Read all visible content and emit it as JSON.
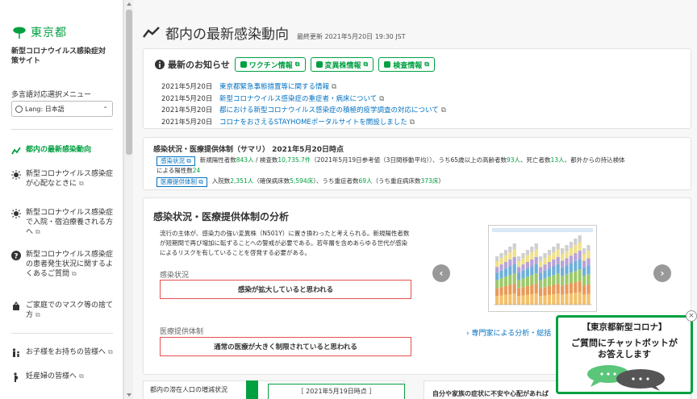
{
  "sidebar": {
    "logo_text": "東京都",
    "site_title": "新型コロナウイルス感染症対策サイト",
    "lang_label": "多言語対応選択メニュー",
    "lang_select_value": "Lang: 日本語",
    "nav": [
      {
        "label": "都内の最新感染動向"
      },
      {
        "label": "新型コロナウイルス感染症が心配なときに"
      },
      {
        "label": "新型コロナウイルス感染症で入院・宿泊療養される方へ"
      },
      {
        "label": "新型コロナウイルス感染症の患者発生状況に関するよくあるご質問"
      },
      {
        "label": "ご家庭でのマスク等の捨て方"
      },
      {
        "label": "お子様をお持ちの皆様へ"
      },
      {
        "label": "妊産婦の皆様へ"
      }
    ]
  },
  "header": {
    "title": "都内の最新感染動向",
    "updated": "最終更新 2021年5月20日 19:30 JST"
  },
  "news": {
    "title": "最新のお知らせ",
    "pills": [
      "ワクチン情報",
      "変異株情報",
      "検査情報"
    ],
    "items": [
      {
        "date": "2021年5月20日",
        "text": "東京都緊急事態措置等に関する情報"
      },
      {
        "date": "2021年5月20日",
        "text": "新型コロナウイルス感染症の重症者・病床について"
      },
      {
        "date": "2021年5月20日",
        "text": "都における新型コロナウイルス感染症の積極的疫学調査の対応について"
      },
      {
        "date": "2021年5月20日",
        "text": "コロナをおさえるSTAYHOMEポータルサイトを開設しました"
      }
    ]
  },
  "summary": {
    "title": "感染状況・医療提供体制（サマリ） 2021年5月20日時点",
    "tag1": "感染状況",
    "row1_a": "新規陽性者数",
    "row1_b": "843人",
    "row1_c": " / 検査数",
    "row1_d": "10,735.7件",
    "row1_e": "（2021年5月19日参考値（3日間移動平均））、うち65歳以上の高齢者数",
    "row1_f": "93人",
    "row1_g": "、死亡者数",
    "row1_h": "13人",
    "row1_i": "、都外からの持込検体",
    "row1_cont_a": "による陽性数",
    "row1_cont_b": "24",
    "tag2": "医療提供体制",
    "row2_a": "入院数",
    "row2_b": "2,351人",
    "row2_c": "（確保病床数",
    "row2_d": "5,594床",
    "row2_e": "）、うち重症者数",
    "row2_f": "69人",
    "row2_g": "（うち重症病床数",
    "row2_h": "373床",
    "row2_i": "）"
  },
  "analysis": {
    "title": "感染状況・医療提供体制の分析",
    "text": "流行の主体が、感染力の強い変異株（N501Y）に置き換わったと考えられる。新規陽性者数が短期間で再び増加に転ずることへの警戒が必要である。若年層を含めあらゆる世代が感染によるリスクを有していることを啓発する必要がある。",
    "infection_label": "感染状況",
    "infection_status": "感染が拡大していると思われる",
    "medical_label": "医療提供体制",
    "medical_status": "通常の医療が大きく制限されていると思われる",
    "expert_link": "専門家による分析・総括",
    "prev_glyph": "‹",
    "next_glyph": "›"
  },
  "bottom": {
    "left_title": "都内の滞在人口の増減状況",
    "mid_date": "［ 2021年5月19日時点 ］",
    "right_title": "自分や家族の症状に不安や心配があれば"
  },
  "chatbot": {
    "title": "【東京都新型コロナ】",
    "message_line1": "ご質問にチャットボットが",
    "message_line2": "お答えします",
    "close": "×"
  },
  "colors": {
    "brand_green": "#00a040",
    "link_blue": "#0071c2",
    "alert_red": "#e85050"
  }
}
